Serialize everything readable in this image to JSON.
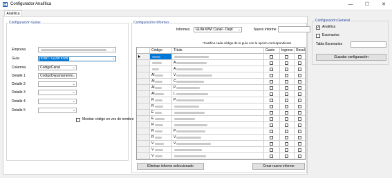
{
  "window": {
    "title": "Configurador Analítica",
    "minimize": "—",
    "maximize": "☐",
    "close": "✕"
  },
  "tabs": [
    {
      "label": "Analítica"
    }
  ],
  "guias": {
    "group_label": "Configuración Guías",
    "empresa_label": "Empresa",
    "guia_label": "Guía",
    "guia_value": "KIWI - GUÍA KIWI",
    "columna_label": "Columna",
    "columna_value": "CodigoCanal",
    "detalle1_label": "Detalle 1",
    "detalle1_value": "CodigoDepartamento",
    "detalle2_label": "Detalle 2",
    "detalle3_label": "Detalle 3",
    "detalle4_label": "Detalle 4",
    "detalle5_label": "Detalle 5",
    "mostrar_label": "Mostrar código en vez de nombre"
  },
  "informes": {
    "group_label": "Configuración Informes",
    "informes_label": "Informes",
    "informes_value": "GUIA KIWI Canal - Dept",
    "nuevo_label": "Nuevo informe",
    "note": "*Casifica cada código de la guía con la opción correspondiente.",
    "columns": [
      "Código",
      "Título",
      "Gasto",
      "Ingreso",
      "Result"
    ],
    "rows": [
      {
        "code": "",
        "title": ""
      },
      {
        "code": "",
        "title": "A"
      },
      {
        "code": "",
        "title": "A"
      },
      {
        "code": "Al",
        "title": "V"
      },
      {
        "code": "Al",
        "title": "C"
      },
      {
        "code": "Al",
        "title": "P"
      },
      {
        "code": "Al",
        "title": "L"
      },
      {
        "code": "R",
        "title": "P"
      },
      {
        "code": "R",
        "title": ""
      },
      {
        "code": "E",
        "title": ""
      },
      {
        "code": "E",
        "title": ""
      },
      {
        "code": "R",
        "title": ""
      },
      {
        "code": "R",
        "title": "P"
      },
      {
        "code": "R",
        "title": "V"
      },
      {
        "code": "V",
        "title": "V"
      },
      {
        "code": "V",
        "title": ""
      },
      {
        "code": "V",
        "title": ""
      }
    ],
    "delete_button": "Eliminar informe seleccionado",
    "create_button": "Crear nuevo informe"
  },
  "general": {
    "group_label": "Configuración General",
    "analitica_label": "Analítica",
    "analitica_checked": true,
    "escenarios_label": "Escenarios",
    "escenarios_checked": false,
    "tabla_label": "Tabla Escenarios",
    "save_button": "Guardar configuración"
  }
}
